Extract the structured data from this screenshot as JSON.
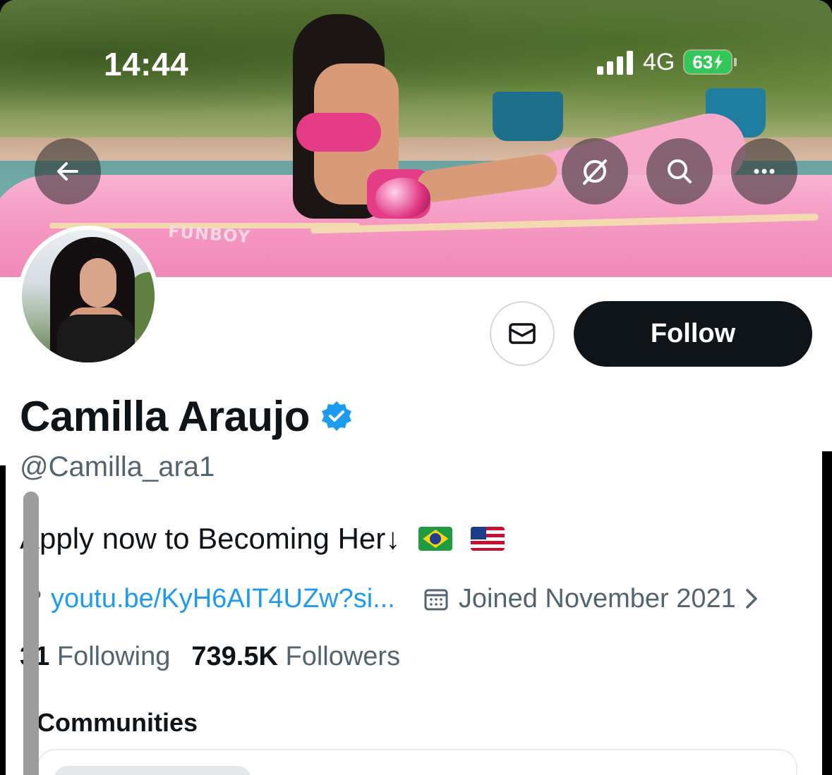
{
  "status_bar": {
    "time": "14:44",
    "network": "4G",
    "battery": "63",
    "battery_color": "#33c759"
  },
  "banner": {
    "float_text": "FUNBOY",
    "buttons": [
      {
        "name": "back",
        "icon": "arrow-left-icon"
      },
      {
        "name": "grok",
        "icon": "grok-icon"
      },
      {
        "name": "search",
        "icon": "search-icon"
      },
      {
        "name": "more",
        "icon": "more-horizontal-icon"
      }
    ]
  },
  "profile": {
    "name": "Camilla Araujo",
    "verified": true,
    "verified_color": "#1d9bf0",
    "handle": "@Camilla_ara1",
    "bio": "Apply now to Becoming Her↓",
    "bio_flags": [
      "brazil-flag",
      "usa-flag"
    ],
    "link": "youtu.be/KyH6AIT4UZw?si...",
    "joined": "Joined November 2021",
    "following_count": "31",
    "following_label": "Following",
    "followers_count": "739.5K",
    "followers_label": "Followers"
  },
  "actions": {
    "follow_label": "Follow",
    "message_icon": "envelope-icon"
  },
  "sections": {
    "communities_title": "Communities"
  },
  "colors": {
    "accent": "#1d9bf0",
    "primary_text": "#0f1419",
    "secondary_text": "#536471",
    "follow_button_bg": "#0f1419"
  }
}
